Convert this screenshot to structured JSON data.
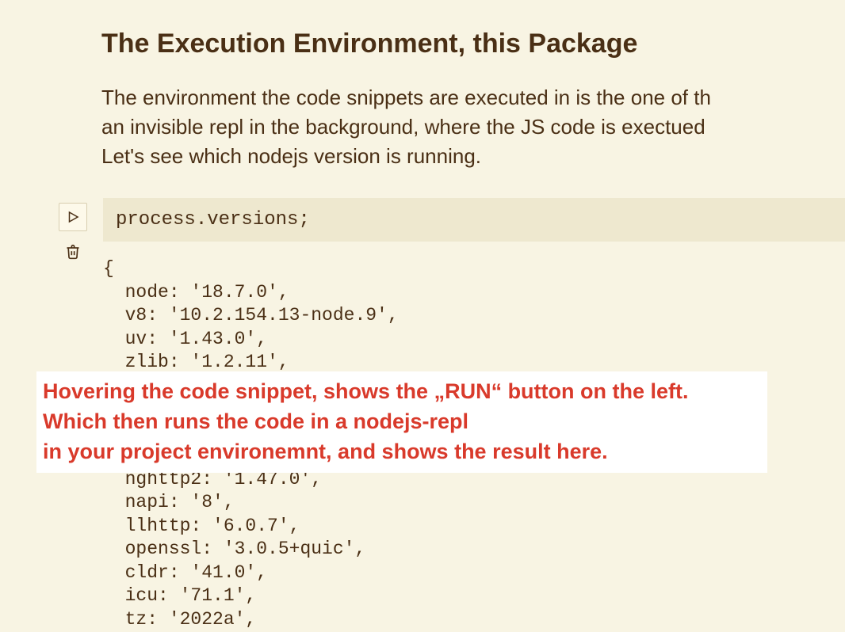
{
  "heading": "The Execution Environment, this Package",
  "intro_line1": "The environment the code snippets are executed in is the one of th",
  "intro_line2": "an invisible repl in the background, where the JS code is exectued",
  "intro_line3": "Let's see which nodejs version is running.",
  "code_input": "process.versions;",
  "output": {
    "open": "{",
    "lines": [
      "  node: '18.7.0',",
      "  v8: '10.2.154.13-node.9',",
      "  uv: '1.43.0',",
      "  zlib: '1.2.11',",
      "",
      "",
      "",
      "",
      "  nghttp2: '1.47.0',",
      "  napi: '8',",
      "  llhttp: '6.0.7',",
      "  openssl: '3.0.5+quic',",
      "  cldr: '41.0',",
      "  icu: '71.1',",
      "  tz: '2022a',"
    ]
  },
  "callout_line1": "Hovering the code snippet, shows the „RUN“ button on the left.",
  "callout_line2": "Which then runs the code in a nodejs-repl",
  "callout_line3": "in your project environemnt, and shows the result here.",
  "icons": {
    "run": "play-icon",
    "trash": "trash-icon"
  }
}
